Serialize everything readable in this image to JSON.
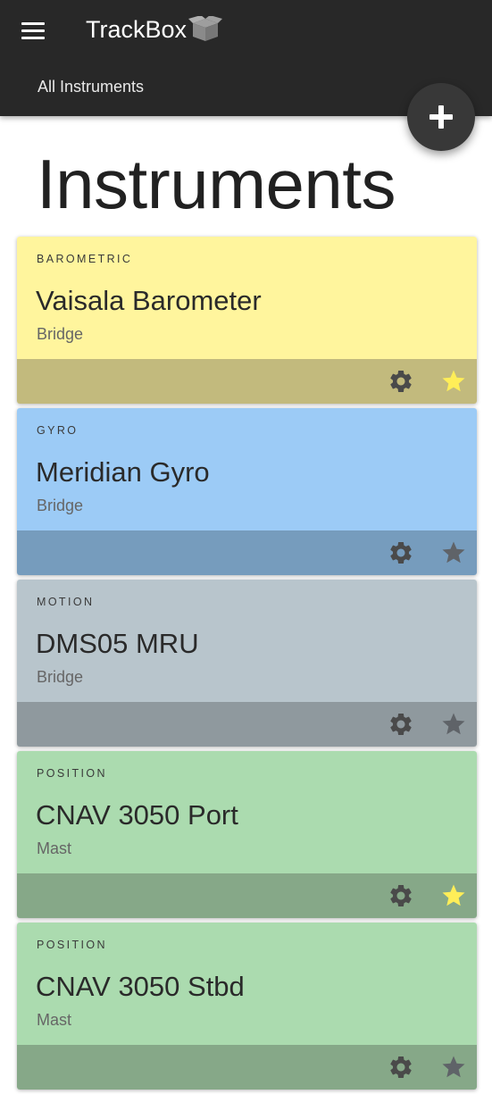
{
  "header": {
    "app_title": "TrackBox",
    "breadcrumb": "All Instruments",
    "background": "#282828"
  },
  "icons": {
    "menu": "hamburger-menu-icon",
    "logo": "box-icon",
    "fab": "plus-icon",
    "settings": "gear-icon",
    "favorite": "star-icon"
  },
  "page": {
    "title": "Instruments"
  },
  "instruments": [
    {
      "type": "BAROMETRIC",
      "name": "Vaisala Barometer",
      "location": "Bridge",
      "favorite": true,
      "body_color": "#fff59d",
      "actions_color": "#c2ba7d"
    },
    {
      "type": "GYRO",
      "name": "Meridian Gyro",
      "location": "Bridge",
      "favorite": false,
      "body_color": "#9ccbf6",
      "actions_color": "#769cbd"
    },
    {
      "type": "MOTION",
      "name": "DMS05 MRU",
      "location": "Bridge",
      "favorite": false,
      "body_color": "#b8c5cc",
      "actions_color": "#8f999e"
    },
    {
      "type": "POSITION",
      "name": "CNAV 3050 Port",
      "location": "Mast",
      "favorite": true,
      "body_color": "#abdbaf",
      "actions_color": "#86a888"
    },
    {
      "type": "POSITION",
      "name": "CNAV 3050 Stbd",
      "location": "Mast",
      "favorite": false,
      "body_color": "#abdbaf",
      "actions_color": "#86a888"
    }
  ],
  "colors": {
    "star_active": "#ffee58",
    "star_inactive": "#5f6368",
    "gear": "#4a4a4a"
  }
}
